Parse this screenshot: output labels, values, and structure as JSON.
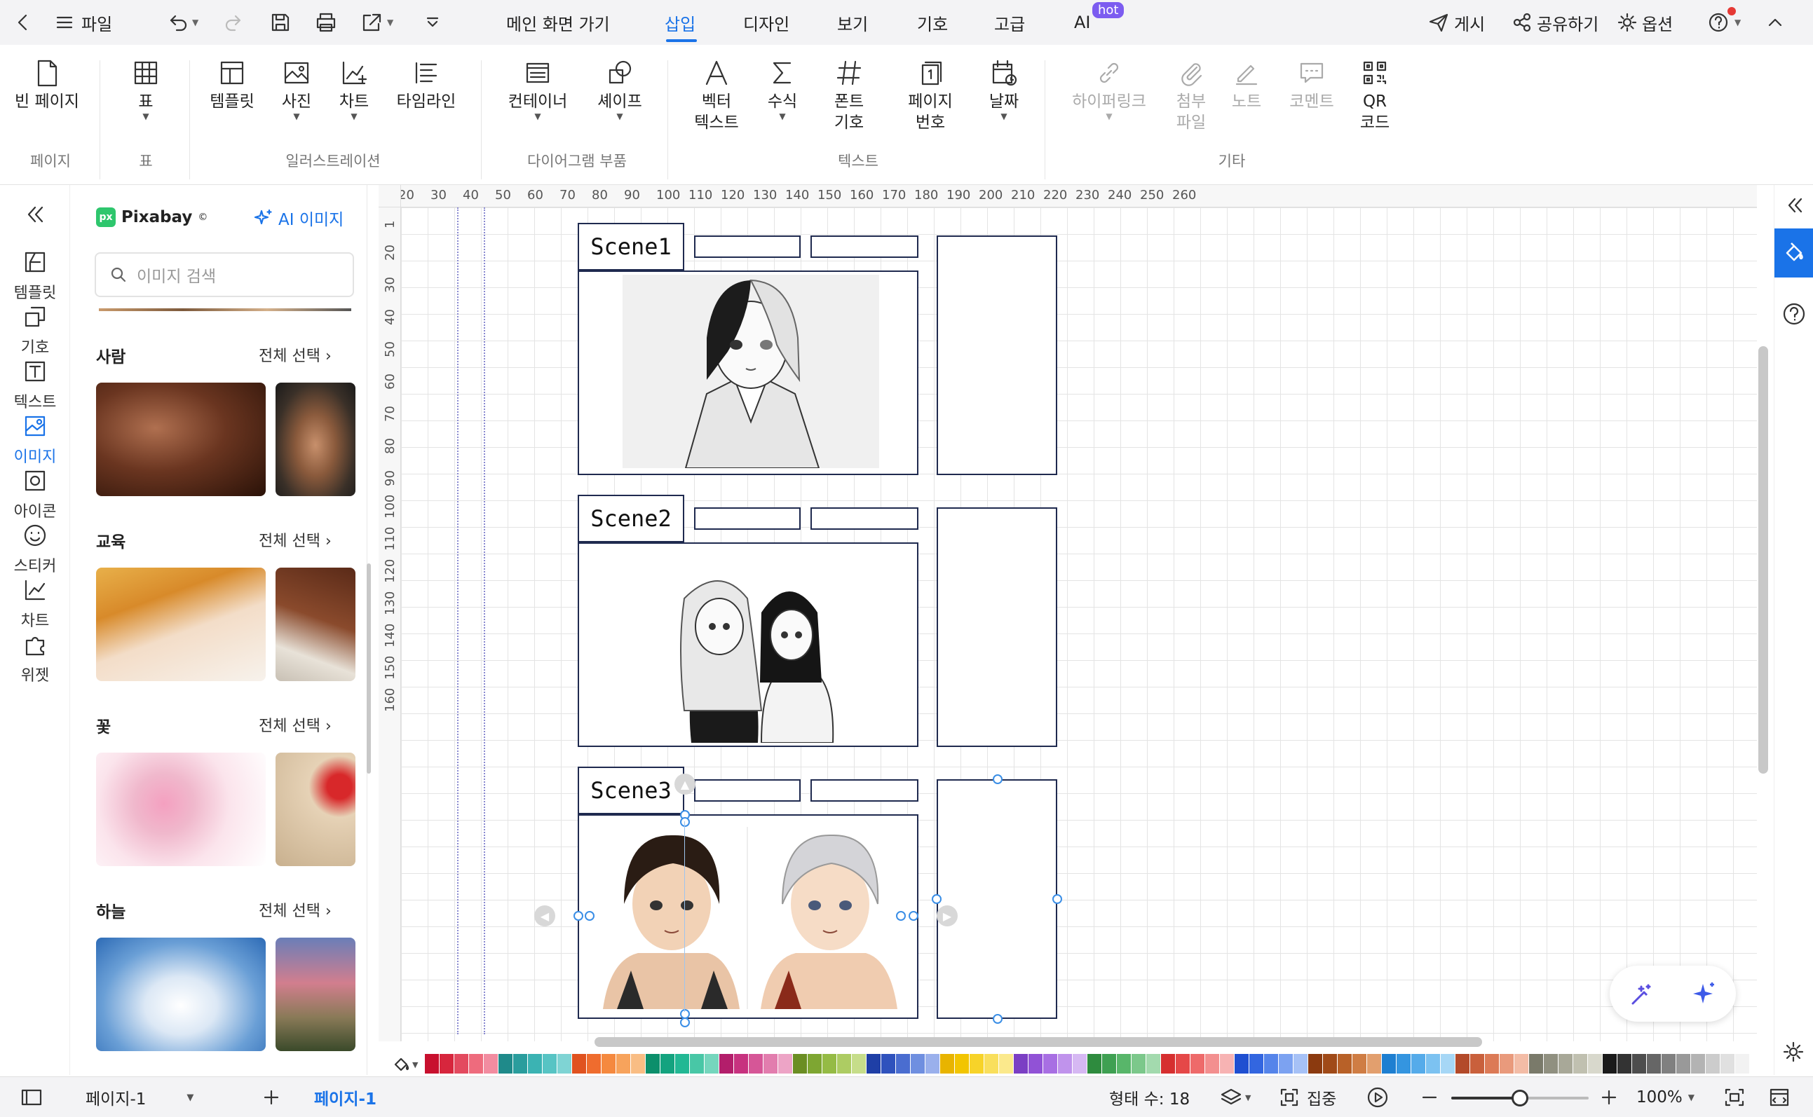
{
  "titlebar": {
    "file": "파일",
    "menu": [
      {
        "label": "메인 화면 가기"
      },
      {
        "label": "삽입"
      },
      {
        "label": "디자인"
      },
      {
        "label": "보기"
      },
      {
        "label": "기호"
      },
      {
        "label": "고급"
      },
      {
        "label": "AI"
      }
    ],
    "hot_badge": "hot",
    "publish": "게시",
    "share": "공유하기",
    "options": "옵션"
  },
  "ribbon": {
    "buttons": {
      "blank_page": "빈 페이지",
      "table": "표",
      "template": "템플릿",
      "photo": "사진",
      "chart": "차트",
      "timeline": "타임라인",
      "container": "컨테이너",
      "shape": "셰이프",
      "vector_text_1": "벡터",
      "vector_text_2": "텍스트",
      "formula": "수식",
      "font_symbol_1": "폰트",
      "font_symbol_2": "기호",
      "page_number_1": "페이지",
      "page_number_2": "번호",
      "date": "날짜",
      "hyperlink": "하이퍼링크",
      "attachment_1": "첨부",
      "attachment_2": "파일",
      "note": "노트",
      "comment": "코멘트",
      "qr_1": "QR",
      "qr_2": "코드"
    },
    "groups": {
      "page": "페이지",
      "table": "표",
      "illustration": "일러스트레이션",
      "diagram_parts": "다이어그램 부품",
      "text": "텍스트",
      "other": "기타"
    }
  },
  "rail": {
    "items": [
      "템플릿",
      "기호",
      "텍스트",
      "이미지",
      "아이콘",
      "스티커",
      "차트",
      "위젯"
    ],
    "active": "이미지"
  },
  "library": {
    "brand": "Pixabay",
    "brand_mark": "©",
    "ai_image": "AI 이미지",
    "search_placeholder": "이미지 검색",
    "categories": [
      {
        "title": "사람",
        "select_all": "전체 선택"
      },
      {
        "title": "교육",
        "select_all": "전체 선택"
      },
      {
        "title": "꽃",
        "select_all": "전체 선택"
      },
      {
        "title": "하늘",
        "select_all": "전체 선택"
      }
    ]
  },
  "ruler": {
    "h": [
      "20",
      "30",
      "40",
      "50",
      "60",
      "70",
      "80",
      "90",
      "100",
      "110",
      "120",
      "130",
      "140",
      "150",
      "160",
      "170",
      "180",
      "190",
      "200",
      "210",
      "220",
      "230",
      "240",
      "250",
      "260"
    ],
    "v": [
      "1",
      "20",
      "30",
      "40",
      "50",
      "60",
      "70",
      "80",
      "90",
      "100",
      "110",
      "120",
      "130",
      "140",
      "150",
      "160"
    ]
  },
  "canvas": {
    "scenes": [
      "Scene1",
      "Scene2",
      "Scene3"
    ]
  },
  "status": {
    "page_selector": "페이지-1",
    "page_tab": "페이지-1",
    "shape_count": "형태 수: 18",
    "focus": "집중",
    "zoom": "100%",
    "zoom_level": 0.5
  },
  "colors": {
    "accent": "#1a73e8",
    "frame": "#1f2a4f",
    "selection": "#3a8ee6",
    "palette": [
      "#c8102e",
      "#d7263d",
      "#e34a5f",
      "#ee6b7d",
      "#f28ca0",
      "#1f8a8a",
      "#2a9d9d",
      "#3bb3b3",
      "#57c4c4",
      "#7fd4d4",
      "#e0521f",
      "#ef6c2e",
      "#f5893f",
      "#f7a35c",
      "#f9bd84",
      "#0c8f6b",
      "#14a37f",
      "#22b894",
      "#48c7a6",
      "#75d6bd",
      "#b31e6b",
      "#c7327f",
      "#d65697",
      "#e27dae",
      "#eda4c6",
      "#6b8e23",
      "#7ea632",
      "#95bb45",
      "#adcc63",
      "#c6dd8a",
      "#1f3fa6",
      "#2f52bd",
      "#4a6dd0",
      "#6f8fe0",
      "#9ab0ec",
      "#e8b400",
      "#f2c500",
      "#f7d329",
      "#f9df5c",
      "#fbe98c",
      "#7b3fc4",
      "#9152d6",
      "#a86fe3",
      "#c093ec",
      "#d6b8f3",
      "#2e8b3e",
      "#3fa052",
      "#58b66a",
      "#7cc88b",
      "#a3daae",
      "#d62f2f",
      "#e54848",
      "#ee6a6a",
      "#f38f8f",
      "#f7b3b3",
      "#1f4fd1",
      "#3366e0",
      "#5584ea",
      "#7ca2f1",
      "#a6c1f6",
      "#8b3a0f",
      "#a04a18",
      "#b86128",
      "#cf7d44",
      "#e29f6e",
      "#1e7fd1",
      "#3495e0",
      "#55abea",
      "#7cc2f1",
      "#a6d7f6",
      "#b34a2a",
      "#c9603c",
      "#dc7a56",
      "#e99a7c",
      "#f3bca6",
      "#7a7a6a",
      "#909080",
      "#a8a898",
      "#c0c0b0",
      "#d8d8cc",
      "#1a1a1a",
      "#333333",
      "#4d4d4d",
      "#666666",
      "#808080",
      "#999999",
      "#b3b3b3",
      "#cccccc",
      "#e0e0e0",
      "#f2f2f2"
    ]
  }
}
